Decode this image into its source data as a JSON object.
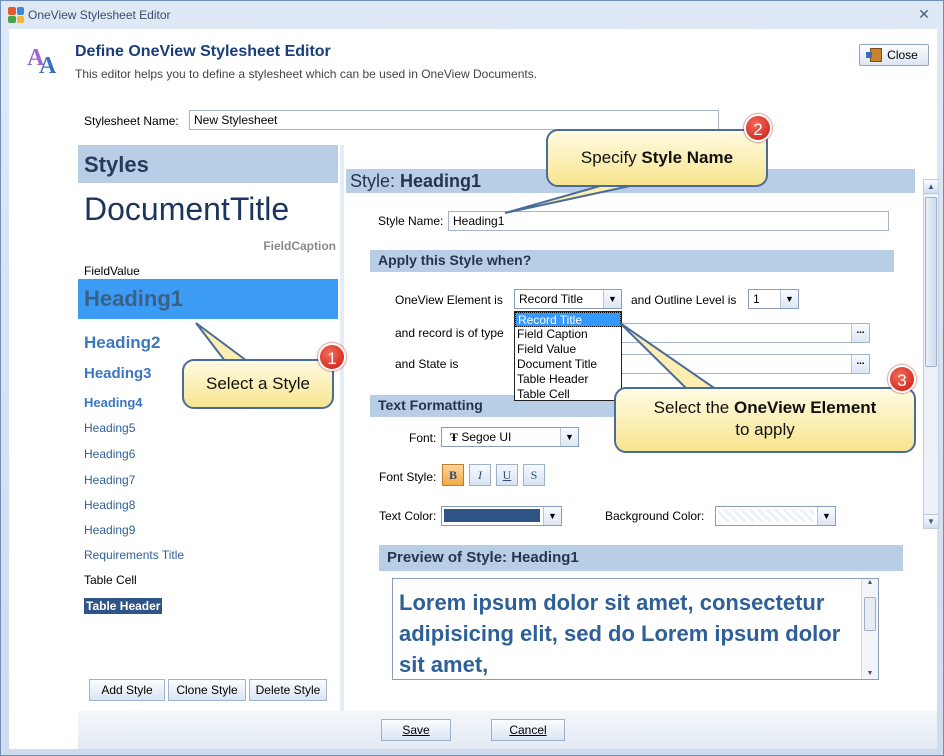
{
  "window": {
    "title": "OneView Stylesheet Editor",
    "close_glyph": "✕"
  },
  "header": {
    "title": "Define OneView Stylesheet Editor",
    "subtitle": "This editor helps you to define a stylesheet  which can be used in OneView Documents.",
    "close_label": "Close"
  },
  "stylesheet": {
    "name_label": "Stylesheet Name:",
    "name_value": "New Stylesheet"
  },
  "styles_panel": {
    "header": "Styles",
    "items": [
      {
        "label": "DocumentTitle"
      },
      {
        "label": "FieldCaption"
      },
      {
        "label": "FieldValue"
      },
      {
        "label": "Heading1"
      },
      {
        "label": "Heading2"
      },
      {
        "label": "Heading3"
      },
      {
        "label": "Heading4"
      },
      {
        "label": "Heading5"
      },
      {
        "label": "Heading6"
      },
      {
        "label": "Heading7"
      },
      {
        "label": "Heading8"
      },
      {
        "label": "Heading9"
      },
      {
        "label": "Requirements Title"
      },
      {
        "label": "Table Cell"
      },
      {
        "label": "Table Header"
      }
    ],
    "selected": "Heading1",
    "add_label": "Add Style",
    "clone_label": "Clone Style",
    "delete_label": "Delete Style"
  },
  "style_editor": {
    "title_prefix": "Style: ",
    "title_name": "Heading1",
    "name_label": "Style Name:",
    "name_value": "Heading1",
    "apply_section": "Apply this Style when?",
    "element_label": "OneView Element is",
    "element_value": "Record Title",
    "element_options": [
      "Record Title",
      "Field Caption",
      "Field Value",
      "Document Title",
      "Table Header",
      "Table Cell"
    ],
    "outline_label": "and Outline Level is",
    "outline_value": "1",
    "record_type_label": "and record is of type",
    "state_label": "and State is",
    "ellipsis": "...",
    "text_format_section": "Text Formatting",
    "font_label": "Font:",
    "font_value": "Segoe UI",
    "font_style_label": "Font Style:",
    "bold": "B",
    "italic": "I",
    "underline": "U",
    "strike": "S",
    "text_color_label": "Text Color:",
    "text_color": "#2e5585",
    "bg_color_label": "Background Color:",
    "preview_title_prefix": "Preview of Style:  ",
    "preview_title_name": "Heading1",
    "preview_text": "Lorem ipsum dolor sit amet, consectetur adipisicing elit, sed do Lorem ipsum dolor sit amet,"
  },
  "footer": {
    "save_label": "Save",
    "cancel_label": "Cancel"
  },
  "callouts": {
    "c1": {
      "text": "Select a Style",
      "number": "1"
    },
    "c2": {
      "text_prefix": "Specify ",
      "text_bold": "Style Name",
      "number": "2"
    },
    "c3": {
      "line1_prefix": "Select the ",
      "line1_bold": "OneView Element",
      "line2": "to apply",
      "number": "3"
    }
  },
  "colors": {
    "accent": "#1a3d7c",
    "selection": "#3b9bf5",
    "panel_header": "#b8cde6",
    "callout_fill": "#fbeeb0",
    "badge": "#d9261c"
  }
}
